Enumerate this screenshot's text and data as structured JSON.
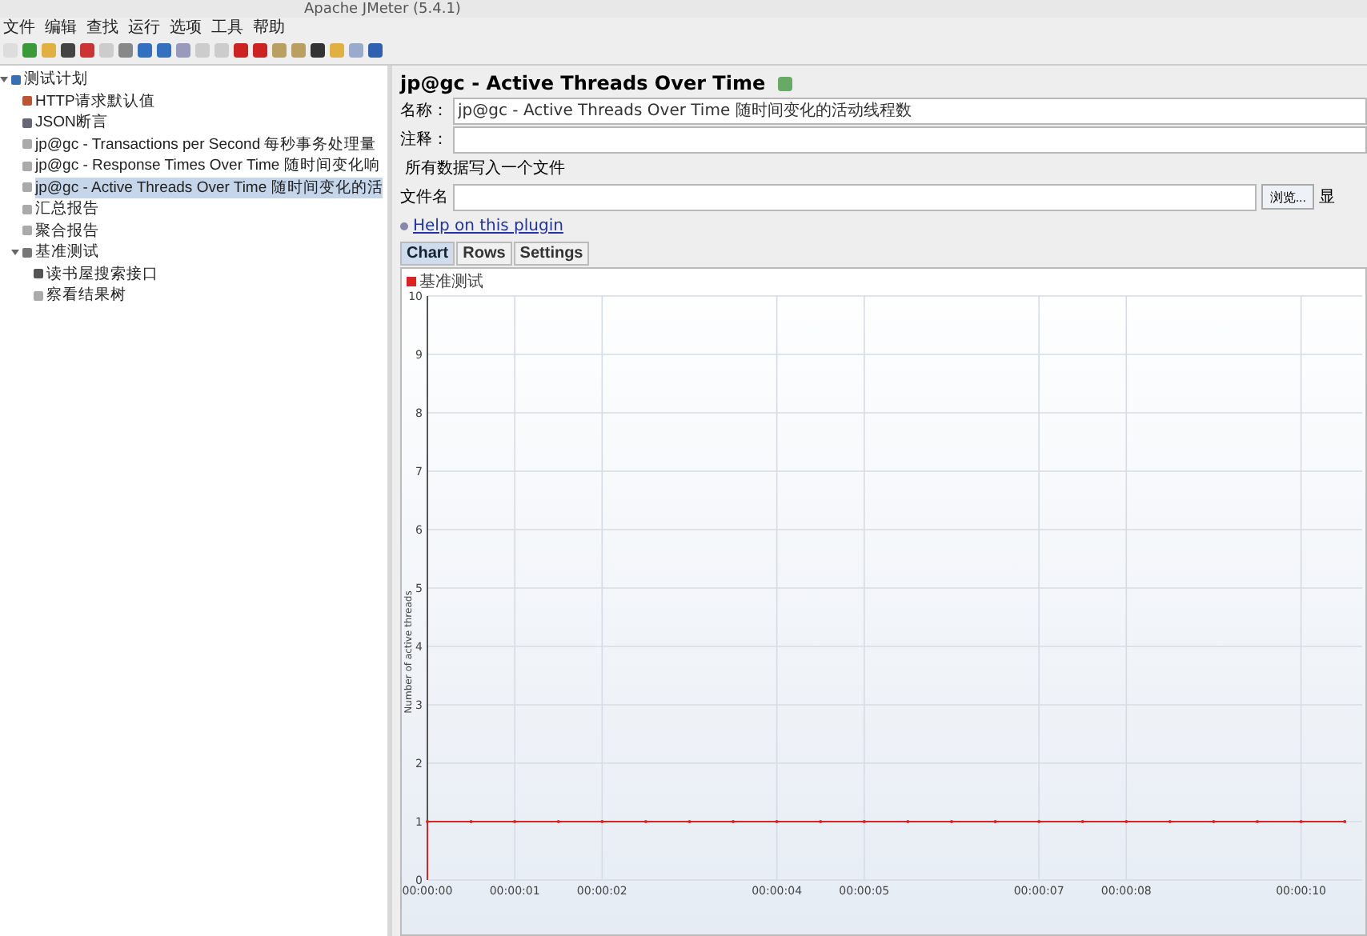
{
  "window": {
    "title": "Apache JMeter (5.4.1)"
  },
  "menu": [
    "文件",
    "编辑",
    "查找",
    "运行",
    "选项",
    "工具",
    "帮助"
  ],
  "tree": [
    {
      "label": "测试计划",
      "kind": "plan",
      "selected": false,
      "expanded": true,
      "children": [
        {
          "label": "HTTP请求默认值",
          "kind": "config",
          "selected": false
        },
        {
          "label": "JSON断言",
          "kind": "assertion",
          "selected": false
        },
        {
          "label": "jp@gc - Transactions per Second 每秒事务处理量",
          "kind": "listener",
          "selected": false
        },
        {
          "label": "jp@gc - Response Times Over Time 随时间变化响",
          "kind": "listener",
          "selected": false
        },
        {
          "label": "jp@gc - Active Threads Over Time 随时间变化的活",
          "kind": "listener",
          "selected": true
        },
        {
          "label": "汇总报告",
          "kind": "listener",
          "selected": false
        },
        {
          "label": "聚合报告",
          "kind": "listener",
          "selected": false
        },
        {
          "label": "基准测试",
          "kind": "threadgroup",
          "selected": false,
          "expanded": true,
          "children": [
            {
              "label": "读书屋搜索接口",
              "kind": "sampler",
              "selected": false
            },
            {
              "label": "察看结果树",
              "kind": "listener",
              "selected": false
            }
          ]
        }
      ]
    }
  ],
  "panel": {
    "title": "jp@gc - Active Threads Over Time",
    "name_label": "名称：",
    "name_value": "jp@gc - Active Threads Over Time 随时间变化的活动线程数",
    "comment_label": "注释：",
    "file_section": "所有数据写入一个文件",
    "file_label": "文件名",
    "browse_button": "浏览...",
    "cut_label": "显",
    "help_link": "Help on this plugin",
    "tabs": [
      {
        "label": "Chart",
        "selected": true
      },
      {
        "label": "Rows",
        "selected": false
      },
      {
        "label": "Settings",
        "selected": false
      }
    ],
    "chart_data": {
      "type": "line",
      "ylabel": "Number of active threads",
      "x": [
        0,
        0,
        0.5,
        1,
        1.5,
        2,
        2.5,
        3,
        3.5,
        4,
        4.5,
        5,
        5.5,
        6,
        6.5,
        7,
        7.5,
        8,
        8.5,
        9,
        9.5,
        10,
        10.5
      ],
      "series": [
        {
          "name": "基准测试",
          "color": "#dd2222",
          "values": [
            0,
            1,
            1,
            1,
            1,
            1,
            1,
            1,
            1,
            1,
            1,
            1,
            1,
            1,
            1,
            1,
            1,
            1,
            1,
            1,
            1,
            1,
            1
          ]
        }
      ],
      "xlim": [
        0,
        10.7
      ],
      "ylim": [
        0,
        10
      ],
      "xticks": [
        {
          "value": 0,
          "label": "00:00:00"
        },
        {
          "value": 1,
          "label": "00:00:01"
        },
        {
          "value": 2,
          "label": "00:00:02"
        },
        {
          "value": 4,
          "label": "00:00:04"
        },
        {
          "value": 5,
          "label": "00:00:05"
        },
        {
          "value": 7,
          "label": "00:00:07"
        },
        {
          "value": 8,
          "label": "00:00:08"
        },
        {
          "value": 10,
          "label": "00:00:10"
        }
      ],
      "grid": true,
      "yticks": [
        0,
        1,
        2,
        3,
        4,
        5,
        6,
        7,
        8,
        9,
        10
      ]
    }
  }
}
